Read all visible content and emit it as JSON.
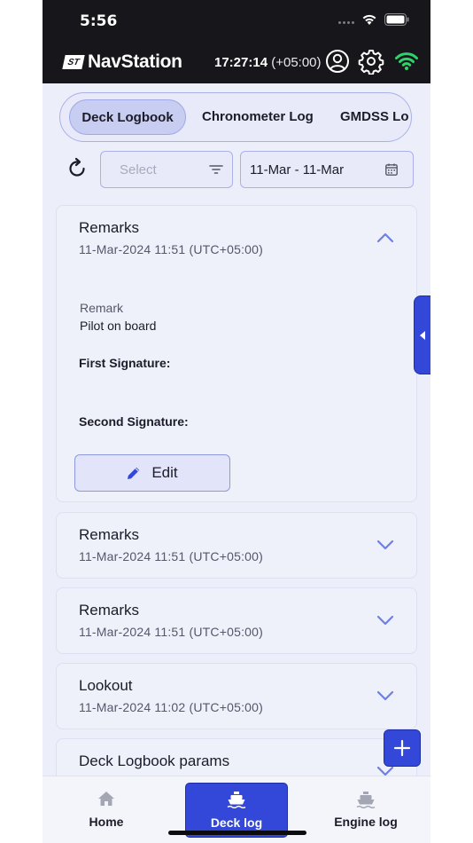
{
  "status_bar": {
    "time": "5:56"
  },
  "header": {
    "app_name": "NavStation",
    "logo_badge": "ST",
    "clock": "17:27:14",
    "timezone": "(+05:00)",
    "icons": [
      "account-circle-icon",
      "gear-icon",
      "wifi-icon"
    ]
  },
  "tabs": [
    {
      "label": "Deck Logbook",
      "active": true
    },
    {
      "label": "Chronometer Log",
      "active": false
    },
    {
      "label": "GMDSS Lo",
      "active": false
    }
  ],
  "filters": {
    "select_placeholder": "Select",
    "date_range": "11-Mar - 11-Mar"
  },
  "cards": [
    {
      "title": "Remarks",
      "date": "11-Mar-2024 11:51 (UTC+05:00)",
      "expanded": true,
      "remark_label": "Remark",
      "remark_value": "Pilot on board",
      "first_signature_label": "First Signature:",
      "second_signature_label": "Second Signature:",
      "edit_label": "Edit"
    },
    {
      "title": "Remarks",
      "date": "11-Mar-2024 11:51 (UTC+05:00)",
      "expanded": false
    },
    {
      "title": "Remarks",
      "date": "11-Mar-2024 11:51 (UTC+05:00)",
      "expanded": false
    },
    {
      "title": "Lookout",
      "date": "11-Mar-2024 11:02 (UTC+05:00)",
      "expanded": false
    },
    {
      "title": "Deck Logbook params",
      "expanded": false
    }
  ],
  "bottom_nav": [
    {
      "label": "Home",
      "icon": "home-icon",
      "active": false
    },
    {
      "label": "Deck log",
      "icon": "ship-icon",
      "active": true
    },
    {
      "label": "Engine log",
      "icon": "ship-icon",
      "active": false
    }
  ],
  "colors": {
    "accent": "#3347d8",
    "header_bg": "#17171b",
    "page_bg": "#eceef9",
    "wifi": "#2fd36b",
    "chevron": "#6d7fe6"
  }
}
